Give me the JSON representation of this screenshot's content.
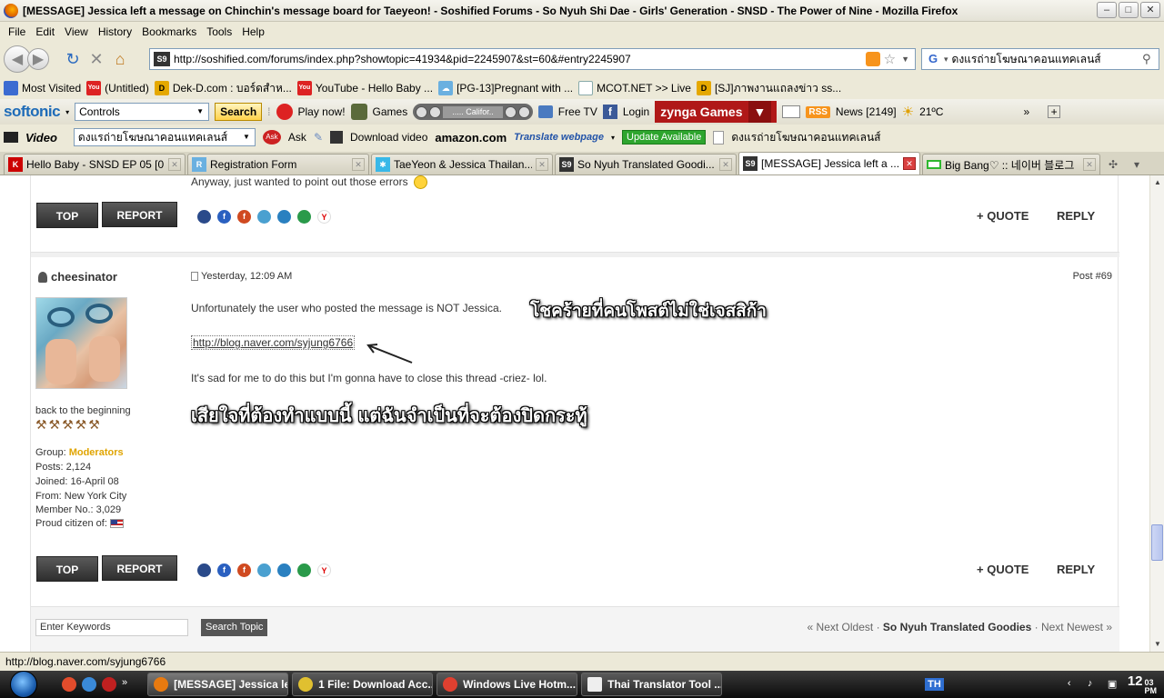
{
  "window": {
    "title": "[MESSAGE] Jessica left a message on Chinchin's message board for Taeyeon! - Soshified Forums - So Nyuh Shi Dae - Girls' Generation - SNSD - The Power of Nine - Mozilla Firefox",
    "min": "–",
    "max": "□",
    "close": "✕"
  },
  "menu": [
    "File",
    "Edit",
    "View",
    "History",
    "Bookmarks",
    "Tools",
    "Help"
  ],
  "nav": {
    "url": "http://soshified.com/forums/index.php?showtopic=41934&pid=2245907&st=60&#entry2245907",
    "site_icon": "S9",
    "search_query": "ดงแรถ่ายโฆษณาคอนแทคเลนส์"
  },
  "bookmarks": [
    {
      "label": "Most Visited",
      "icon": "star-page-icon",
      "color": "#3b6bd1"
    },
    {
      "label": "(Untitled)",
      "icon": "youtube-icon",
      "color": "#d22"
    },
    {
      "label": "Dek-D.com : บอร์ดสำห...",
      "icon": "dekd-icon",
      "color": "#e5a800"
    },
    {
      "label": "YouTube - Hello Baby ...",
      "icon": "youtube-icon",
      "color": "#d22"
    },
    {
      "label": "[PG-13]Pregnant with ...",
      "icon": "cloud-icon",
      "color": "#6ab0e0"
    },
    {
      "label": "MCOT.NET >> Live",
      "icon": "page-icon",
      "color": "#8aa"
    },
    {
      "label": "[SJ]ภาพงานแถลงข่าว ss...",
      "icon": "dekd-icon",
      "color": "#e5a800"
    }
  ],
  "softonic": {
    "logo": "softonic",
    "combo": "Controls",
    "search_btn": "Search",
    "play_now": "Play now!",
    "games": "Games",
    "media_track": "..... Califor..",
    "free_tv": "Free TV",
    "login": "Login",
    "zynga": "zynga Games",
    "rss": "RSS",
    "news": "News [2149]",
    "weather": "21ºC",
    "more": "»"
  },
  "videobar": {
    "logo": "Video",
    "combo": "ดงแรถ่ายโฆษณาคอนแทคเลนส์",
    "ask": "Ask",
    "download": "Download video",
    "amazon": "amazon.com",
    "translate": "Translate webpage",
    "update": "Update Available",
    "last": "ดงแรถ่ายโฆษณาคอนแทคเลนส์"
  },
  "tabs": [
    {
      "label": "Hello Baby - SNSD EP 05 [0...",
      "icon": "K",
      "color": "#c00",
      "active": false
    },
    {
      "label": "Registration Form",
      "icon": "R",
      "color": "#6ab0e0",
      "active": false
    },
    {
      "label": "TaeYeon & Jessica Thailan...",
      "icon": "✱",
      "color": "#38b8e8",
      "active": false
    },
    {
      "label": "So Nyuh Translated Goodi...",
      "icon": "S9",
      "color": "#333",
      "active": false
    },
    {
      "label": "[MESSAGE] Jessica left a ...",
      "icon": "S9",
      "color": "#333",
      "active": true
    },
    {
      "label": "Big Bang♡ :: 네이버 블로그",
      "icon": "▭",
      "color": "#2eb82e",
      "active": false
    }
  ],
  "post_prev": {
    "tail_text": "Anyway, just wanted to point out those errors",
    "top": "TOP",
    "report": "REPORT",
    "quote": "+ QUOTE",
    "reply": "REPLY"
  },
  "post": {
    "author": "cheesinator",
    "date": "Yesterday, 12:09 AM",
    "post_number": "Post #69",
    "line1": "Unfortunately the user who posted the message is NOT Jessica.",
    "thai1": "โชคร้ายที่คนโพสต์ไม่ใช่เจสสิก้า",
    "link": "http://blog.naver.com/syjung6766",
    "line2": "It's sad for me to do this but I'm gonna have to close this thread -criez- lol.",
    "thai2": "เสียใจที่ต้องทำแบบนี้ แต่ฉันจำเป็นที่จะต้องปิดกระทู้",
    "user_title": "back to the beginning",
    "group_label": "Group:",
    "group": "Moderators",
    "posts": "Posts: 2,124",
    "joined": "Joined: 16-April 08",
    "from": "From: New York City",
    "member_no": "Member No.: 3,029",
    "proud": "Proud citizen of:",
    "top": "TOP",
    "report": "REPORT",
    "quote": "+ QUOTE",
    "reply": "REPLY"
  },
  "footer": {
    "keywords": "Enter Keywords",
    "search_topic": "Search Topic",
    "prev": "« Next Oldest",
    "sep": "·",
    "current": "So Nyuh Translated Goodies",
    "next": "Next Newest »"
  },
  "status": "http://blog.naver.com/syjung6766",
  "taskbar": {
    "tasks": [
      {
        "label": "[MESSAGE] Jessica le...",
        "color": "#e87a10",
        "active": true
      },
      {
        "label": "1 File: Download Acc...",
        "color": "#e0c030",
        "active": false
      },
      {
        "label": "Windows Live Hotm...",
        "color": "#e04030",
        "active": false
      },
      {
        "label": "Thai Translator Tool ...",
        "color": "#eee",
        "active": false
      }
    ],
    "lang": "TH",
    "time": "12",
    "time_min": "03",
    "time_ampm": "PM"
  }
}
